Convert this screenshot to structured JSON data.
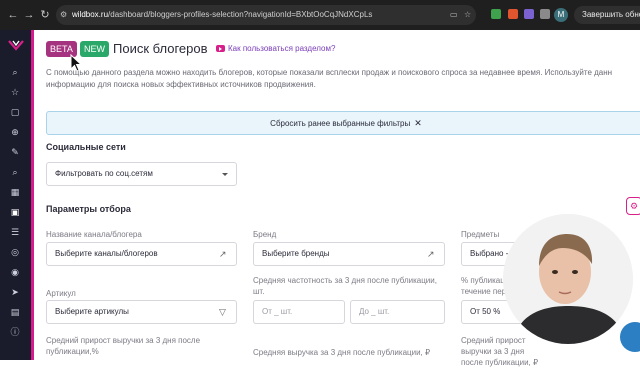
{
  "browser": {
    "url_host": "wildbox.ru",
    "url_path": "/dashboard/bloggers-profiles-selection?navigationId=BXbtOoCqJNdXCpLs",
    "avatar_letter": "M",
    "update_label": "Завершить обнов"
  },
  "page": {
    "badge_beta": "BETA",
    "badge_new": "NEW",
    "title": "Поиск блогеров",
    "help_link": "Как пользоваться разделом?",
    "description": "С помощью данного раздела можно находить блогеров, которые показали всплески продаж и поискового спроса за недавнее время. Используйте данн информацию для поиска новых эффективных источников продвижения.",
    "reset_filters": "Сбросить ранее выбранные фильтры"
  },
  "social": {
    "title": "Социальные сети",
    "select_value": "Фильтровать по соц.сетям"
  },
  "params": {
    "title": "Параметры отбора",
    "channel_label": "Название канала/блогера",
    "channel_placeholder": "Выберите каналы/блогеров",
    "brand_label": "Бренд",
    "brand_placeholder": "Выберите бренды",
    "subjects_label": "Предметы",
    "subjects_value": "Выбрано -",
    "article_label": "Артикул",
    "article_placeholder": "Выберите артикулы",
    "frequency_label": "Средняя частотность за 3 дня после публикации, шт.",
    "frequency_from": "От _ шт.",
    "frequency_to": "До _ шт.",
    "percent_label": "% публикац... течение пер...",
    "percent_value": "От 50 %",
    "growth_label": "Средний прирост выручки за 3 дня после публикации,%",
    "avg_revenue_label": "Средняя выручка за 3 дня после публикации, ₽",
    "growth_rub_label": "Средний прирост выручки за 3 дня после публикации, ₽"
  },
  "colors": {
    "accent": "#d8208a",
    "beta": "#a6337f",
    "new": "#2aa86a",
    "sidebar": "#1a1c2b",
    "reset_bg": "#e9f4fb"
  }
}
